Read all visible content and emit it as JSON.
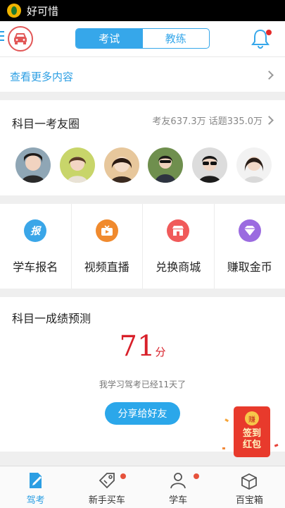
{
  "status_bar": {
    "app_title": "好可惜"
  },
  "header": {
    "tabs": [
      {
        "label": "考试",
        "active": true
      },
      {
        "label": "教练",
        "active": false
      }
    ],
    "notification_dot": true,
    "accent_color": "#36a7ea"
  },
  "more": {
    "label": "查看更多内容"
  },
  "exam_circle": {
    "title": "科目一考友圈",
    "stats": "考友637.3万 话题335.0万"
  },
  "features": [
    {
      "label": "学车报名",
      "icon": "apply-icon",
      "color": "#3aa6e8"
    },
    {
      "label": "视频直播",
      "icon": "tv-icon",
      "color": "#f08a2e"
    },
    {
      "label": "兑换商城",
      "icon": "shop-icon",
      "color": "#f05a5a"
    },
    {
      "label": "赚取金币",
      "icon": "diamond-icon",
      "color": "#9b6be0"
    }
  ],
  "prediction": {
    "title": "科目一成绩预测",
    "score": "71",
    "unit": "分",
    "days_text": "我学习驾考已经11天了",
    "share_label": "分享给好友"
  },
  "red_packet": {
    "coin": "赚",
    "label_line1": "签到",
    "label_line2": "红包"
  },
  "tabbar": [
    {
      "label": "驾考",
      "icon": "exam-icon",
      "active": true,
      "badge": false
    },
    {
      "label": "新手买车",
      "icon": "tag-icon",
      "active": false,
      "badge": true
    },
    {
      "label": "学车",
      "icon": "user-icon",
      "active": false,
      "badge": true
    },
    {
      "label": "百宝箱",
      "icon": "box-icon",
      "active": false,
      "badge": false
    }
  ]
}
